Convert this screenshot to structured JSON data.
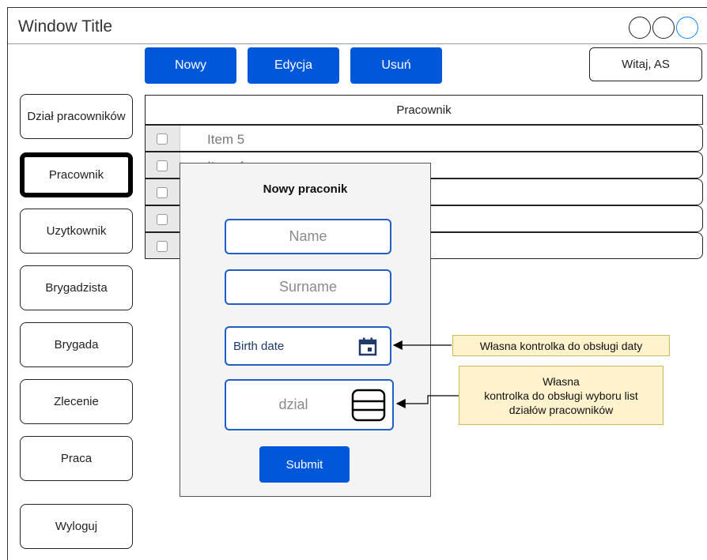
{
  "window": {
    "title": "Window Title"
  },
  "toolbar": {
    "new_label": "Nowy",
    "edit_label": "Edycja",
    "delete_label": "Usuń"
  },
  "user": {
    "greeting": "Witaj, AS"
  },
  "sidebar": {
    "items": [
      {
        "label": "Dział pracowników",
        "active": false
      },
      {
        "label": "Pracownik",
        "active": true
      },
      {
        "label": "Uzytkownik",
        "active": false
      },
      {
        "label": "Brygadzista",
        "active": false
      },
      {
        "label": "Brygada",
        "active": false
      },
      {
        "label": "Zlecenie",
        "active": false
      },
      {
        "label": "Praca",
        "active": false
      },
      {
        "label": "Wyloguj",
        "active": false
      }
    ]
  },
  "table": {
    "header": "Pracownik",
    "rows": [
      {
        "label": "Item 5"
      },
      {
        "label": "Item 4"
      },
      {
        "label": ""
      },
      {
        "label": ""
      },
      {
        "label": ""
      }
    ]
  },
  "modal": {
    "title": "Nowy praconik",
    "name_placeholder": "Name",
    "surname_placeholder": "Surname",
    "birth_label": "Birth date",
    "dzial_placeholder": "dzial",
    "submit_label": "Submit"
  },
  "annotations": {
    "date_note": "Własna kontrolka do obsługi daty",
    "list_note_line1": "Własna",
    "list_note_line2": "kontrolka do obsługi wyboru list",
    "list_note_line3": "działów pracowników"
  },
  "colors": {
    "primary": "#0057d9",
    "field_border": "#1f5fc7",
    "note_bg": "#fff2cc",
    "note_border": "#d6b656"
  },
  "icons": {
    "date": "calendar-icon",
    "list": "list-selector-icon"
  }
}
